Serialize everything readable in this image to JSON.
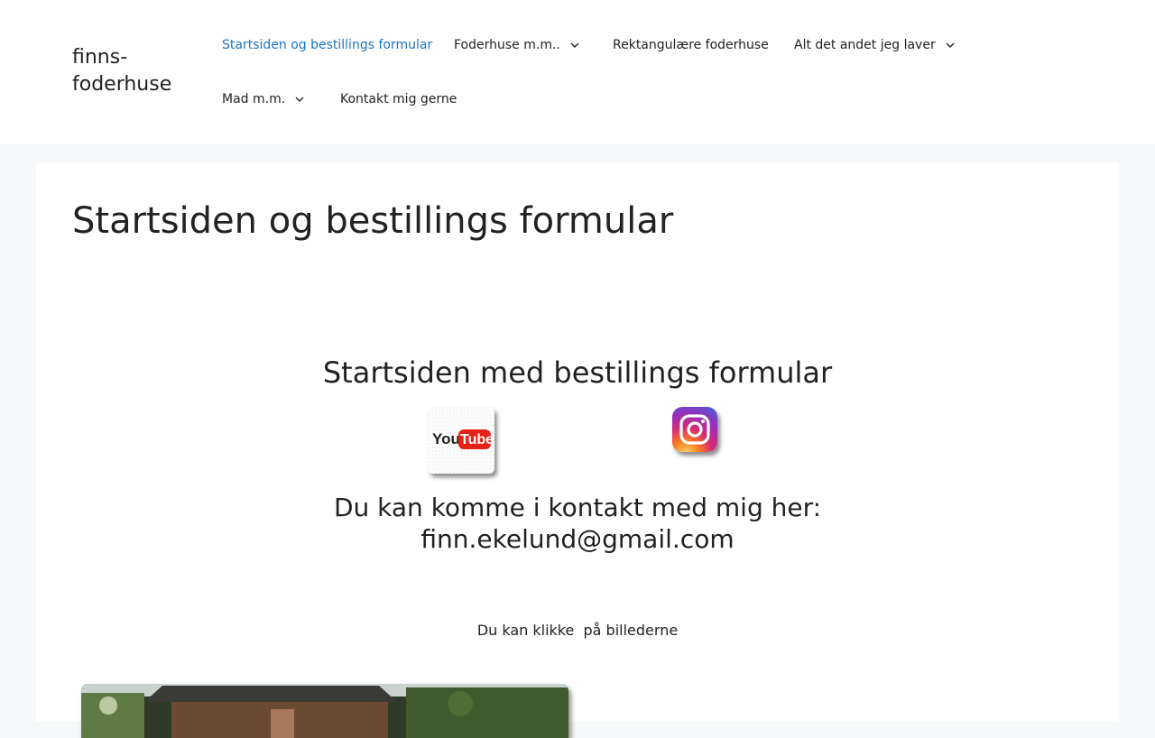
{
  "site": {
    "title": "finns-foderhuse"
  },
  "nav": {
    "items": [
      {
        "label": "Startsiden og bestillings formular",
        "active": true,
        "has_dropdown": false
      },
      {
        "label": "Foderhuse m.m..",
        "active": false,
        "has_dropdown": true
      },
      {
        "label": "Rektangulære foderhuse",
        "active": false,
        "has_dropdown": false
      },
      {
        "label": "Alt det andet jeg laver",
        "active": false,
        "has_dropdown": true
      },
      {
        "label": "Mad m.m.",
        "active": false,
        "has_dropdown": true
      },
      {
        "label": "Kontakt mig gerne",
        "active": false,
        "has_dropdown": false
      }
    ]
  },
  "main": {
    "page_title": "Startsiden og bestillings formular",
    "section_heading": "Startsiden med bestillings formular",
    "social": {
      "youtube_logo_text_1": "You",
      "youtube_logo_text_2": "Tube"
    },
    "contact_line_1": "Du kan komme i kontakt med mig her:",
    "contact_line_2": "finn.ekelund@gmail.com",
    "click_hint": "Du kan klikke  på billederne"
  },
  "colors": {
    "accent": "#1e73be",
    "text": "#222222",
    "page_background": "#f7f8f9",
    "youtube_red": "#e62117",
    "instagram_gradient": [
      "#feda75",
      "#fa7e1e",
      "#d62976",
      "#962fbf",
      "#4f5bd5"
    ]
  }
}
